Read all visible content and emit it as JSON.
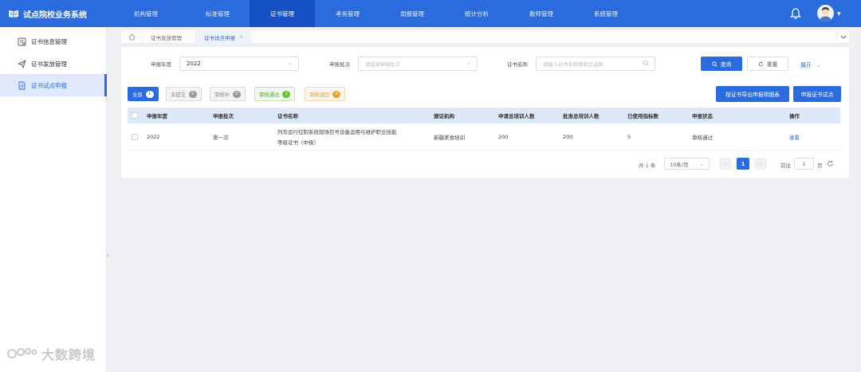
{
  "app": {
    "title": "试点院校业务系统"
  },
  "nav": [
    {
      "label": "机构管理"
    },
    {
      "label": "标准管理"
    },
    {
      "label": "证书管理"
    },
    {
      "label": "考务管理"
    },
    {
      "label": "周报管理"
    },
    {
      "label": "统计分析"
    },
    {
      "label": "教师管理"
    },
    {
      "label": "系统管理"
    }
  ],
  "sidebar": {
    "items": [
      {
        "label": "证书信息管理",
        "icon": "certificate-info-icon"
      },
      {
        "label": "证书发放管理",
        "icon": "send-icon"
      },
      {
        "label": "证书试点申报",
        "icon": "document-icon"
      }
    ]
  },
  "tabs": [
    {
      "label": "证书发放管理"
    },
    {
      "label": "证书试点申报",
      "close": "×"
    }
  ],
  "filters": {
    "year_label": "申报年度",
    "year_value": "2022",
    "batch_label": "申报批次",
    "batch_placeholder": "请选择申报批次",
    "name_label": "证书名称",
    "name_placeholder": "请输入证书名称搜索后选择",
    "query_label": "查询",
    "reset_label": "重置",
    "expand_label": "展开"
  },
  "status_chips": [
    {
      "label": "全部",
      "count": "1"
    },
    {
      "label": "未提交",
      "count": "0"
    },
    {
      "label": "审核中",
      "count": "0"
    },
    {
      "label": "审核通过",
      "count": "1"
    },
    {
      "label": "审核退回",
      "count": "0"
    }
  ],
  "actions": {
    "export_label": "按证书导出申报明细表",
    "apply_label": "申报证书试点"
  },
  "table": {
    "columns": [
      "申报年度",
      "申报批次",
      "证书名称",
      "颁证机构",
      "申请总培训人数",
      "批准总培训人数",
      "已使用指标数",
      "申报状态",
      "操作"
    ],
    "rows": [
      {
        "year": "2022",
        "batch": "第一次",
        "name_line1": "列车运行控制系统现场信号设备运用与维护职业技能",
        "name_line2": "等级证书（中级）",
        "org": "新疆美食培训",
        "applied": "200",
        "approved": "200",
        "used": "5",
        "status": "审核通过",
        "action": "查看"
      }
    ]
  },
  "pagination": {
    "total": "共 1 条",
    "page_size": "10条/页",
    "prev": "‹",
    "current": "1",
    "next": "›",
    "goto_label": "前往",
    "goto_value": "1",
    "goto_suffix": "页"
  },
  "watermark": {
    "text": "大数跨境"
  },
  "colors": {
    "brand": "#2a6bdd",
    "nav_active": "#1550c5",
    "success": "#67c23a",
    "warning": "#e6a23c"
  }
}
